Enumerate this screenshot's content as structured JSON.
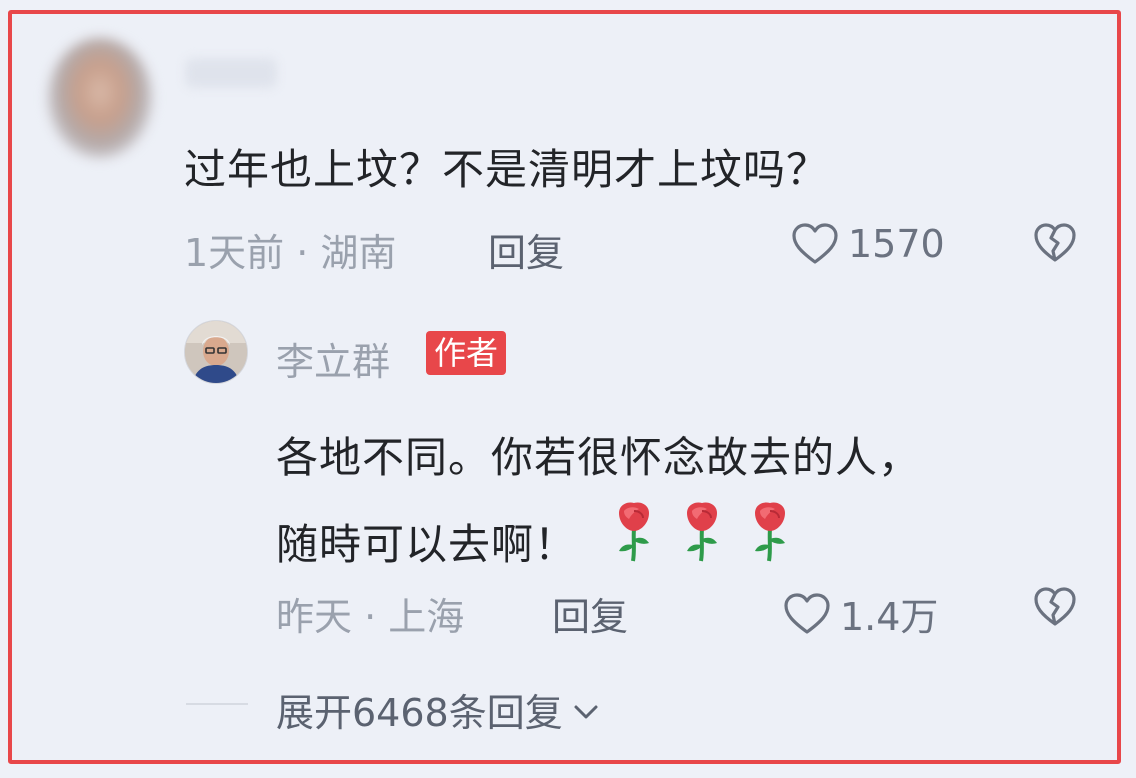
{
  "comment": {
    "text": "过年也上坟？不是清明才上坟吗？",
    "meta": "1天前 · 湖南",
    "reply_label": "回复",
    "likes": "1570"
  },
  "reply": {
    "author": "李立群",
    "badge": "作者",
    "text_line1": "各地不同。你若很怀念故去的人，",
    "text_line2": "随時可以去啊！",
    "emoji": [
      "rose-emoji",
      "rose-emoji",
      "rose-emoji"
    ],
    "meta": "昨天 · 上海",
    "reply_label": "回复",
    "likes": "1.4万"
  },
  "expand_label": "展开6468条回复",
  "colors": {
    "border": "#e8474a",
    "badge": "#e8474a",
    "background": "#edf0f7"
  }
}
